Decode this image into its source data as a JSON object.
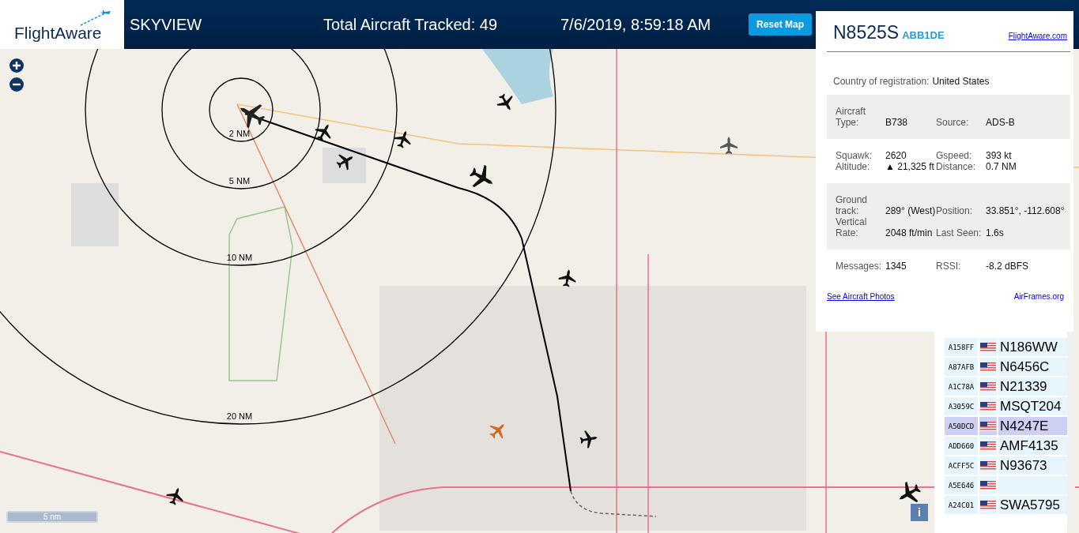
{
  "header": {
    "logo": "FlightAware",
    "app_name": "SKYVIEW",
    "total_tracked": "Total Aircraft Tracked: 49",
    "datetime": "7/6/2019, 8:59:18 AM",
    "reset_button": "Reset Map"
  },
  "map": {
    "range_rings": [
      "2 NM",
      "5 NM",
      "10 NM",
      "20 NM"
    ],
    "scale": "5 nm",
    "info_button": "i"
  },
  "aircraft_panel": {
    "registration": "N8525S",
    "hex": "ABB1DE",
    "link": "FlightAware.com",
    "country_label": "Country of registration:",
    "country": "United States",
    "groups": [
      {
        "fields": [
          {
            "label": "Aircraft Type:",
            "value": "B738"
          },
          {
            "label": "Source:",
            "value": "ADS-B"
          }
        ]
      },
      {
        "fields": [
          {
            "label": "Squawk:",
            "value": "2620"
          },
          {
            "label": "Gspeed:",
            "value": "393 kt"
          },
          {
            "label": "Altitude:",
            "value": "▲ 21,325 ft"
          },
          {
            "label": "Distance:",
            "value": "0.7 NM"
          }
        ]
      },
      {
        "fields": [
          {
            "label": "Ground track:",
            "value": "289° (West)"
          },
          {
            "label": "Position:",
            "value": "33.851°, -112.608°"
          },
          {
            "label": "Vertical Rate:",
            "value": "2048 ft/min"
          },
          {
            "label": "Last Seen:",
            "value": "1.6s"
          }
        ]
      },
      {
        "fields": [
          {
            "label": "Messages:",
            "value": "1345"
          },
          {
            "label": "RSSI:",
            "value": "-8.2 dBFS"
          }
        ]
      }
    ],
    "photos_link": "See Aircraft Photos",
    "airframes_link": "AirFrames.org"
  },
  "aircraft_list": [
    {
      "hex": "A158FF",
      "callsign": "N186WW",
      "selected": false
    },
    {
      "hex": "A87AFB",
      "callsign": "N6456C",
      "selected": false
    },
    {
      "hex": "A1C78A",
      "callsign": "N21339",
      "selected": false
    },
    {
      "hex": "A3059C",
      "callsign": "MSQT204",
      "selected": false
    },
    {
      "hex": "A50DCD",
      "callsign": "N4247E",
      "selected": true
    },
    {
      "hex": "ADD660",
      "callsign": "AMF4135",
      "selected": false
    },
    {
      "hex": "ACFF5C",
      "callsign": "N93673",
      "selected": false
    },
    {
      "hex": "A5E646",
      "selected": false
    },
    {
      "hex": "A24C01",
      "callsign": "SWA5795",
      "selected": false
    }
  ]
}
